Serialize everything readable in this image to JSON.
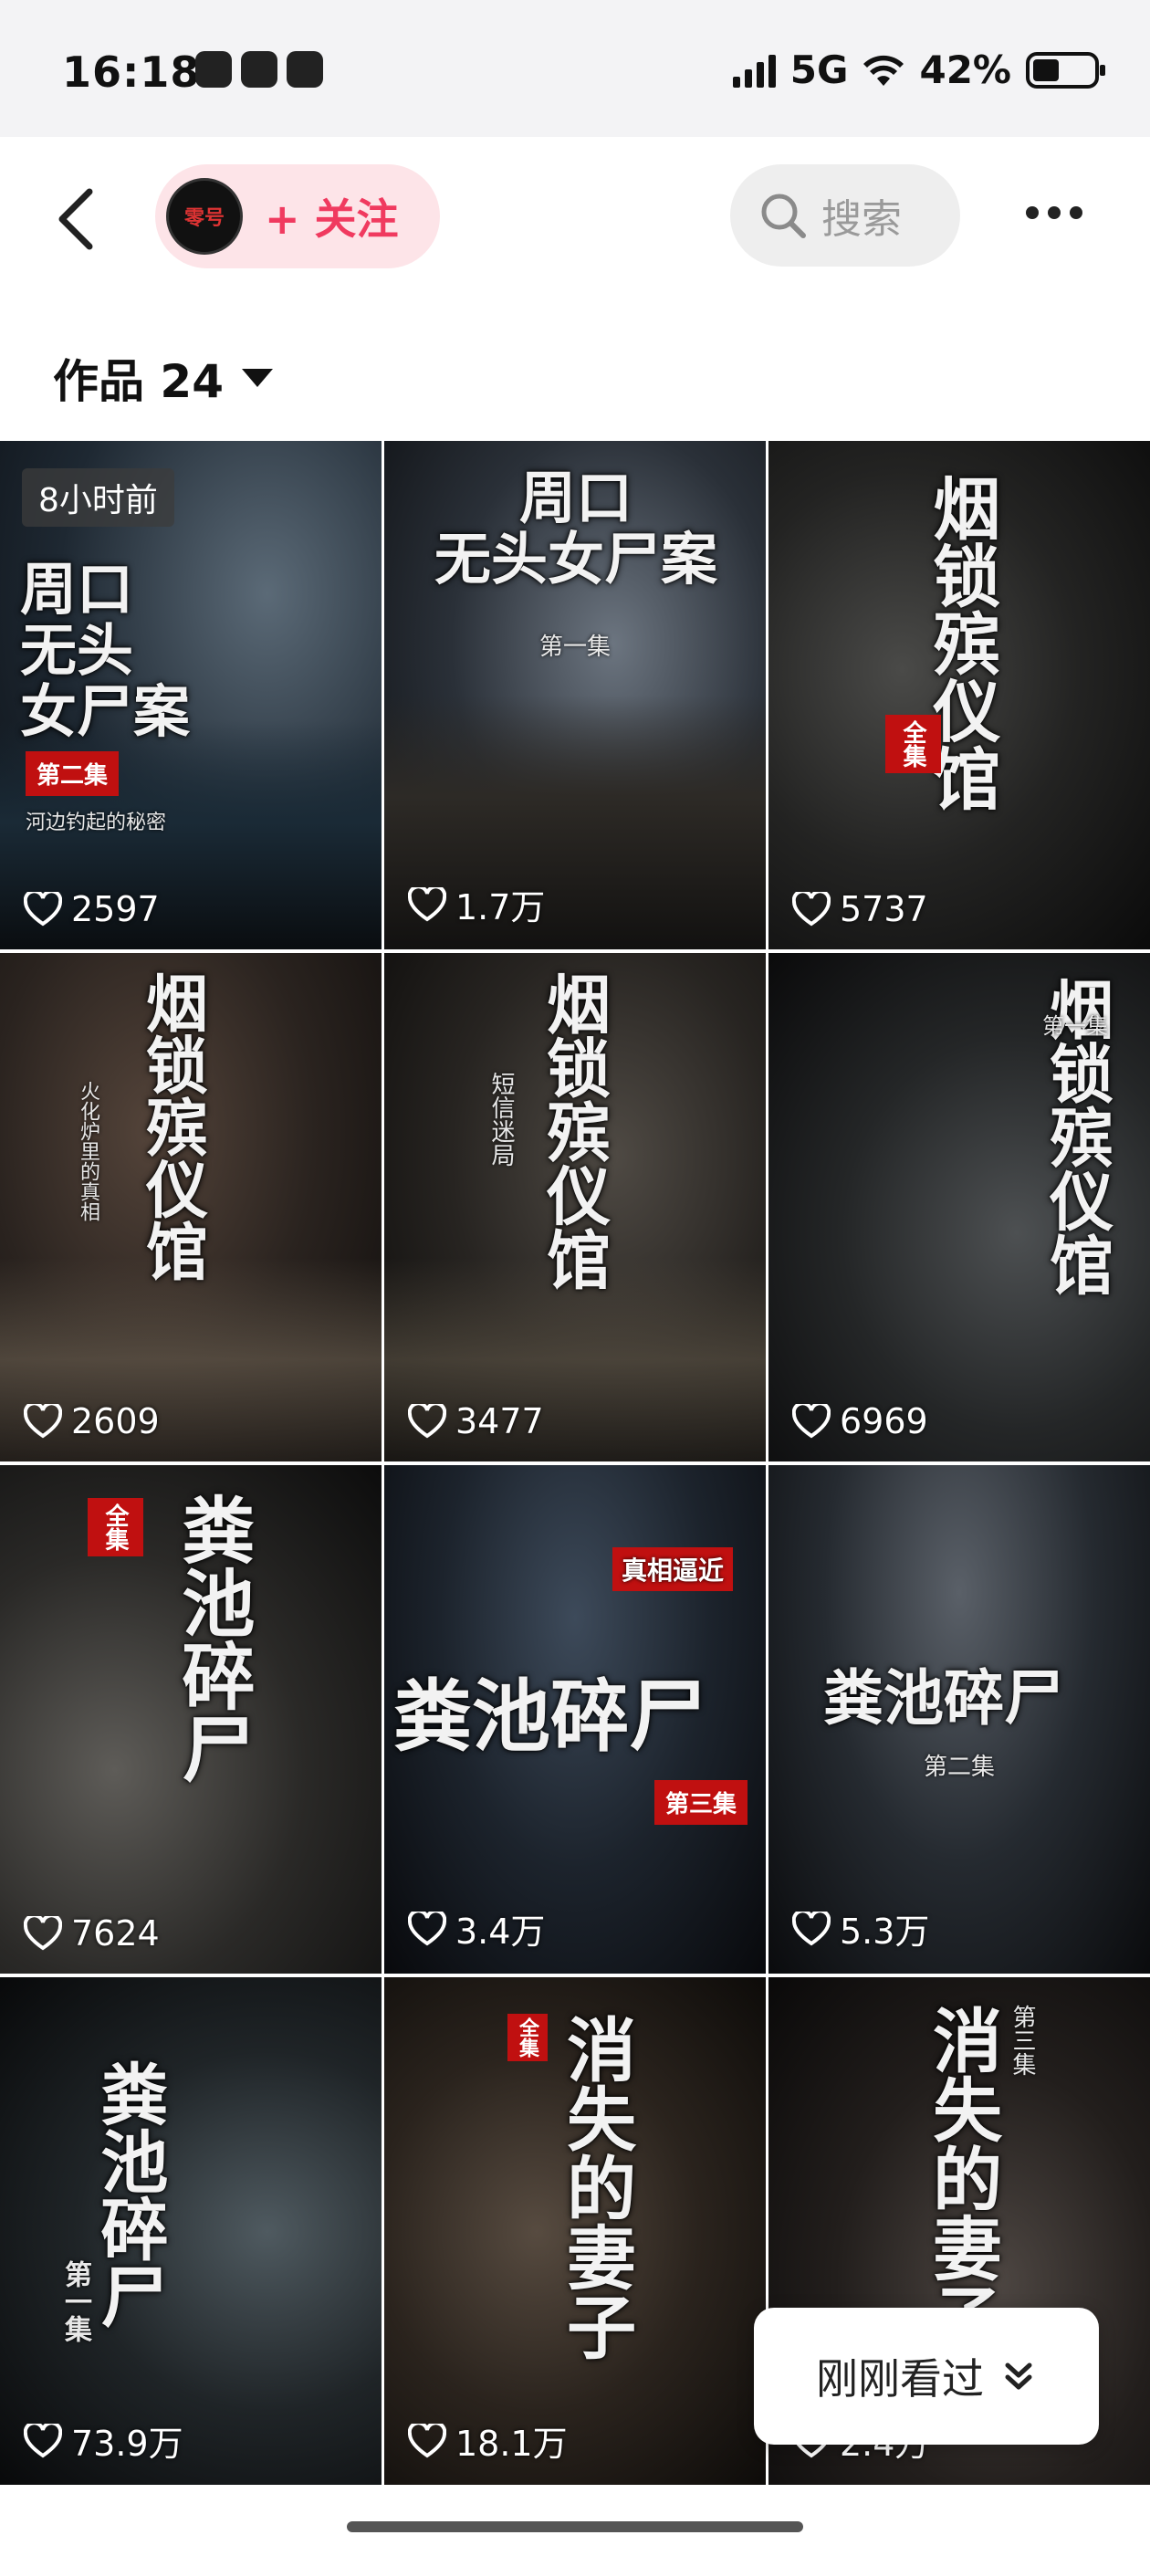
{
  "status_bar": {
    "time": "16:18",
    "network": "5G",
    "battery": "42%"
  },
  "nav": {
    "follow_label": "+ 关注",
    "avatar_text": "零号",
    "search_label": "搜索"
  },
  "works_header": {
    "label": "作品 24"
  },
  "tiles": [
    {
      "likes": "2597",
      "time_badge": "8小时前",
      "title": "周口\n无头\n女尸案",
      "badge": "第二集",
      "sub": "河边钓起的秘密"
    },
    {
      "likes": "1.7万",
      "title": "周口\n无头女尸案",
      "sub": "第一集"
    },
    {
      "likes": "5737",
      "title": "烟锁殡仪馆",
      "badge": "全集"
    },
    {
      "likes": "2609",
      "title": "烟锁殡仪馆",
      "sub": "火化炉里的真相"
    },
    {
      "likes": "3477",
      "title": "烟锁殡仪馆",
      "sub": "短信迷局"
    },
    {
      "likes": "6969",
      "title": "烟锁殡仪馆",
      "sub": "第一集"
    },
    {
      "likes": "7624",
      "title": "粪池碎尸",
      "badge": "全集"
    },
    {
      "likes": "3.4万",
      "title": "粪池碎尸",
      "badge": "第三集",
      "sub": "真相逼近"
    },
    {
      "likes": "5.3万",
      "title": "粪池碎尸",
      "sub": "第二集"
    },
    {
      "likes": "73.9万",
      "title": "粪池碎尸",
      "sub": "第一集"
    },
    {
      "likes": "18.1万",
      "title": "消失的妻子",
      "badge": "全集"
    },
    {
      "likes": "2.4万",
      "title": "消失的妻子",
      "sub": "第三集"
    }
  ],
  "recent": {
    "label": "刚刚看过"
  },
  "colors": {
    "accent": "#f03a5f",
    "badge_red": "#c01010"
  }
}
